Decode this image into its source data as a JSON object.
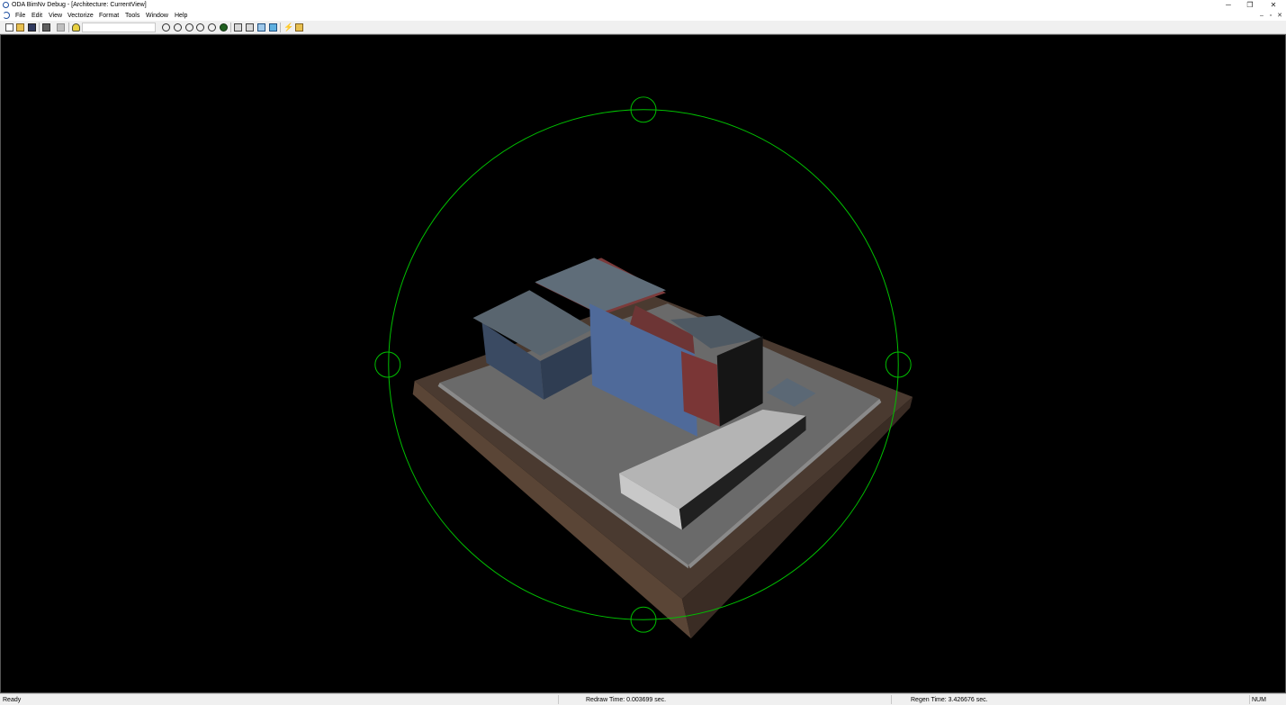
{
  "window": {
    "title": "ODA BimNv Debug - [Architecture: CurrentView]",
    "minimize_glyph": "─",
    "maximize_glyph": "❐",
    "close_glyph": "✕"
  },
  "menu": {
    "items": [
      "File",
      "Edit",
      "View",
      "Vectorize",
      "Format",
      "Tools",
      "Window",
      "Help"
    ]
  },
  "mdi": {
    "minimize_glyph": "–",
    "restore_glyph": "▫",
    "close_glyph": "✕"
  },
  "toolbar": {
    "buttons": [
      "new-icon",
      "open-icon",
      "save-icon",
      "print-icon",
      "print-preview-icon",
      "help-icon",
      "zoom-window-icon",
      "zoom-in-icon",
      "zoom-out-icon",
      "zoom-extents-icon",
      "zoom-realtime-icon",
      "orbit-icon",
      "view-top-icon",
      "view-front-icon",
      "view-iso-icon",
      "view-cube-icon",
      "lightning-icon",
      "render-icon"
    ]
  },
  "viewport": {
    "background": "#000000",
    "orbit_color": "#00c000"
  },
  "status": {
    "ready": "Ready",
    "redraw": "Redraw Time: 0.003699 sec.",
    "regen": "Regen Time: 3.426676 sec.",
    "num": "NUM"
  }
}
